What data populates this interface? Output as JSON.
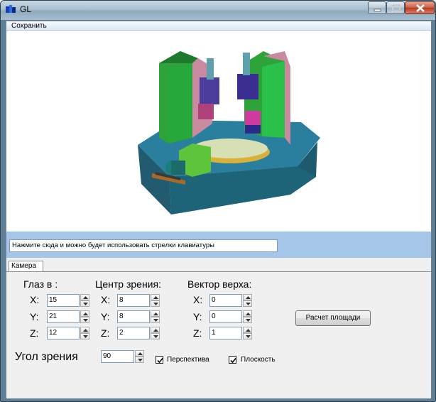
{
  "window": {
    "title": "GL"
  },
  "menu": {
    "save": "Сохранить"
  },
  "hint": {
    "text": "Нажмите сюда и можно будет использовать стрелки клавиатуры"
  },
  "tabs": [
    {
      "label": "Камера"
    }
  ],
  "camera": {
    "eye": {
      "title": "Глаз в :",
      "x_label": "X:",
      "y_label": "Y:",
      "z_label": "Z:",
      "x": "15",
      "y": "21",
      "z": "12"
    },
    "center": {
      "title": "Центр зрения:",
      "x_label": "X:",
      "y_label": "Y:",
      "z_label": "Z:",
      "x": "8",
      "y": "8",
      "z": "2"
    },
    "up": {
      "title": "Вектор верха:",
      "x_label": "X:",
      "y_label": "Y:",
      "z_label": "Z:",
      "x": "0",
      "y": "0",
      "z": "1"
    },
    "calc_button": "Расчет площади",
    "angle": {
      "label": "Угол зрения",
      "value": "90"
    },
    "perspective": {
      "label": "Перспектива",
      "checked": true
    },
    "plane": {
      "label": "Плоскость",
      "checked": true
    }
  },
  "icons": [
    "app-icon",
    "minimize-icon",
    "maximize-icon",
    "close-icon",
    "spin-up-icon",
    "spin-down-icon",
    "checkmark-icon"
  ]
}
